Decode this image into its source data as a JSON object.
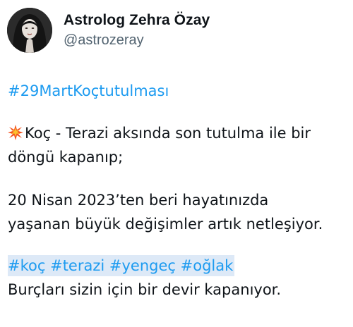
{
  "author": {
    "display_name": "Astrolog Zehra Özay",
    "handle": "@astrozeray"
  },
  "tweet": {
    "hashtag_title": "#29MartKoçtutulması",
    "paragraph1": {
      "emoji": "collision-icon",
      "line1": "Koç - Terazi aksında son tutulma ile bir",
      "line2": "döngü kapanıp;"
    },
    "paragraph2": {
      "line1": "20 Nisan 2023’ten beri hayatınızda",
      "line2": "yaşanan büyük değişimler artık netleşiyor."
    },
    "hashtags": [
      "#koç",
      "#terazi",
      "#yengeç",
      "#oğlak"
    ],
    "closing": "Burçları sizin için bir devir kapanıyor."
  },
  "colors": {
    "hashtag": "#1d9bf0",
    "text": "#0f1419",
    "handle": "#536471",
    "highlight": "#dde9f7"
  }
}
